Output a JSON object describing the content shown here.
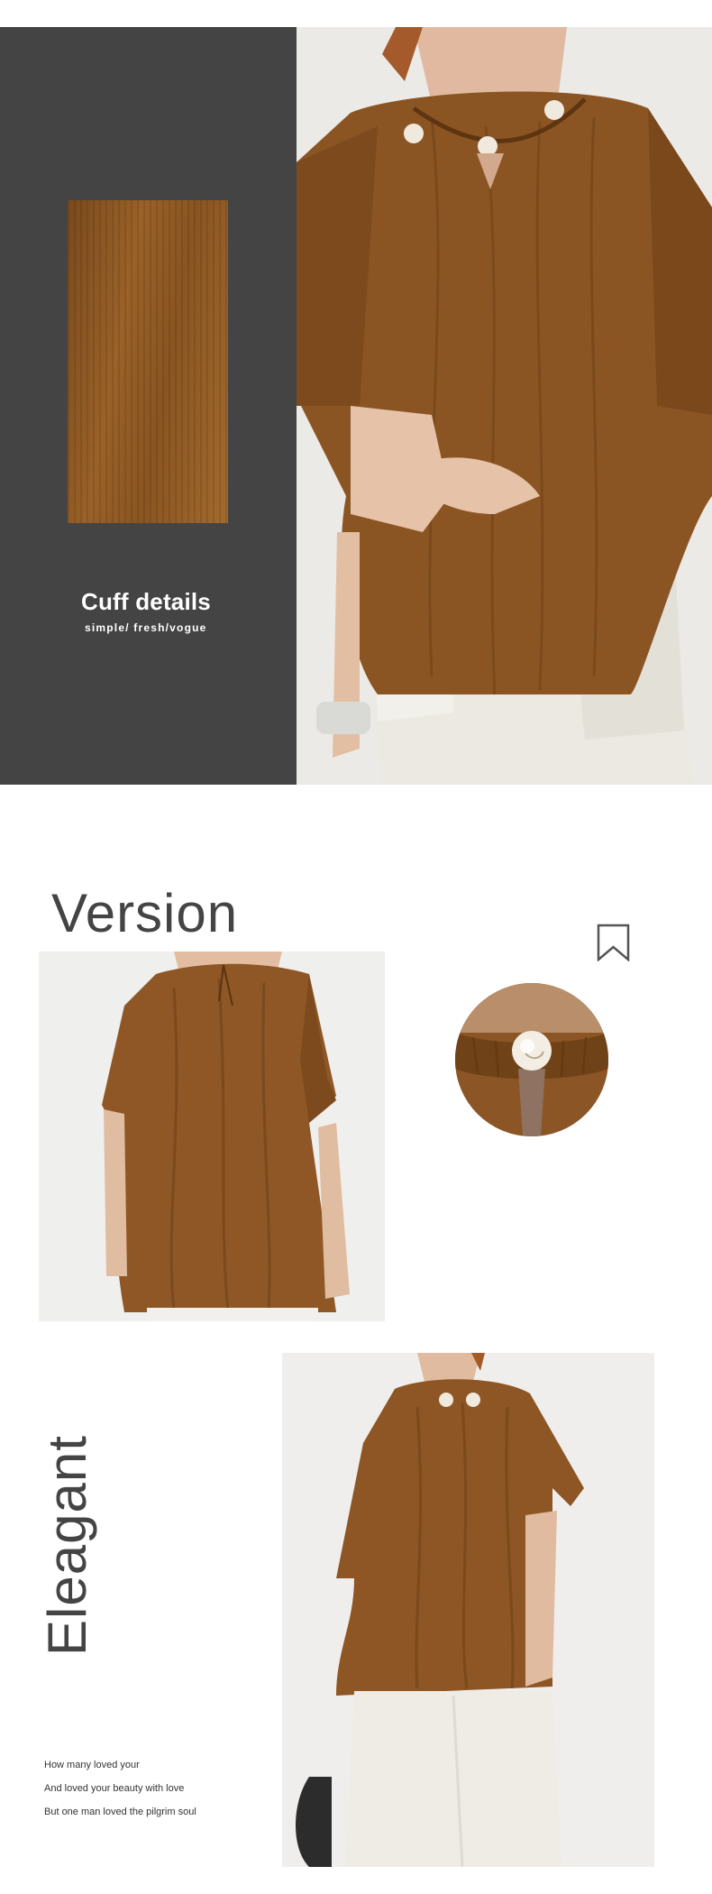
{
  "section1": {
    "title": "Cuff details",
    "subtitle": "simple/ fresh/vogue"
  },
  "section2": {
    "title": "Version"
  },
  "section3": {
    "title": "Eleagant",
    "poem": [
      "How many loved your",
      "And loved your beauty with love",
      "But one man loved the pilgrim soul"
    ]
  },
  "colors": {
    "panel": "#444444",
    "heading": "#444444",
    "fabric": "#8a5424"
  },
  "icons": {
    "bookmark": "bookmark-icon"
  }
}
